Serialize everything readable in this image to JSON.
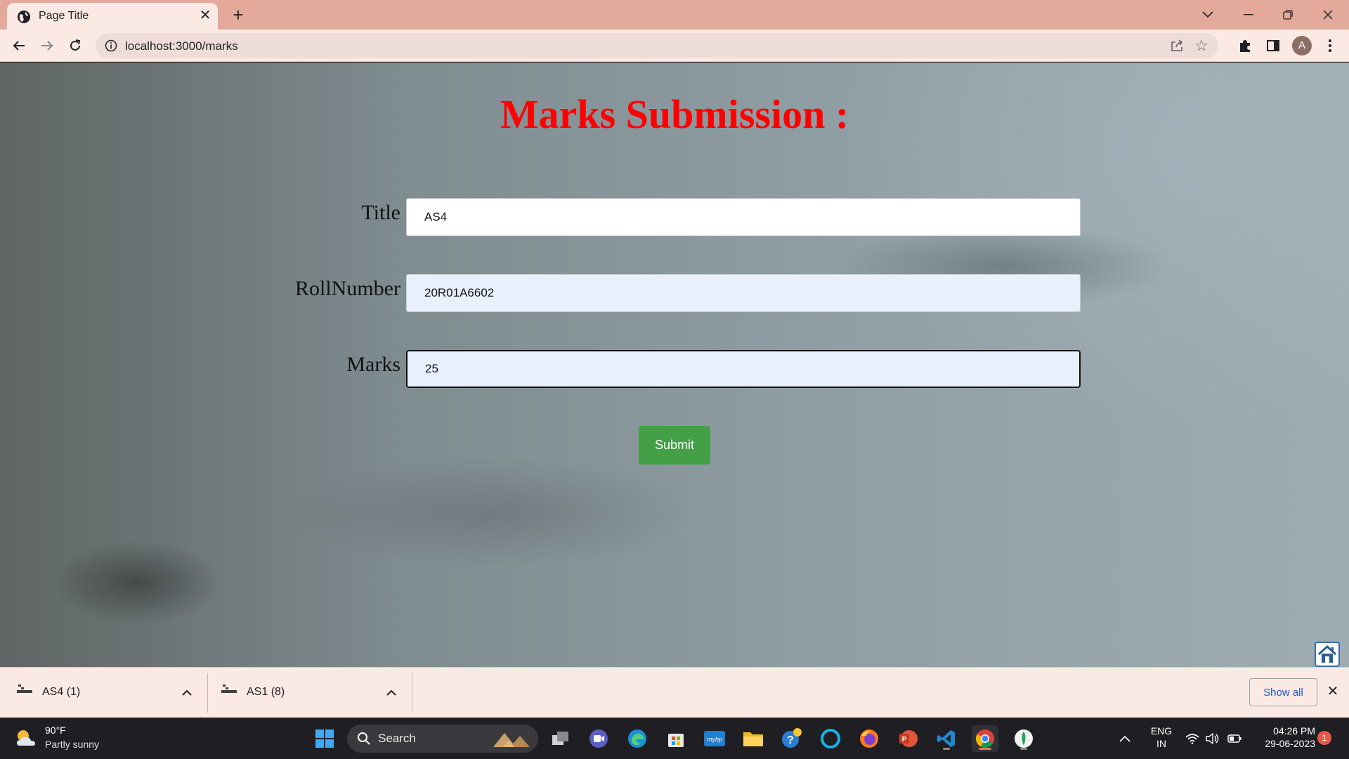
{
  "browser": {
    "tab_title": "Page Title",
    "url": "localhost:3000/marks",
    "profile_initial": "A"
  },
  "page": {
    "title": "Marks Submission :",
    "fields": {
      "title_label": "Title",
      "title_value": "AS4",
      "roll_label": "RollNumber",
      "roll_value": "20R01A6602",
      "marks_label": "Marks",
      "marks_value": "25"
    },
    "submit_label": "Submit",
    "colors": {
      "title": "#ff0000",
      "submit_bg": "#43a047",
      "autofill_bg": "#e8f0fe"
    }
  },
  "downloads": {
    "items": [
      {
        "name": "AS4 (1)"
      },
      {
        "name": "AS1 (8)"
      }
    ],
    "show_all_label": "Show all"
  },
  "taskbar": {
    "weather": {
      "temp": "90°F",
      "desc": "Partly sunny"
    },
    "search_label": "Search",
    "apps": [
      "task-view",
      "teams-chat",
      "edge",
      "microsoft-store",
      "myhp",
      "file-explorer",
      "get-help",
      "alexa",
      "firefox",
      "powerpoint",
      "vscode",
      "chrome",
      "mongodb-compass"
    ],
    "lang_line1": "ENG",
    "lang_line2": "IN",
    "time": "04:26 PM",
    "date": "29-06-2023",
    "notification_count": "1"
  }
}
